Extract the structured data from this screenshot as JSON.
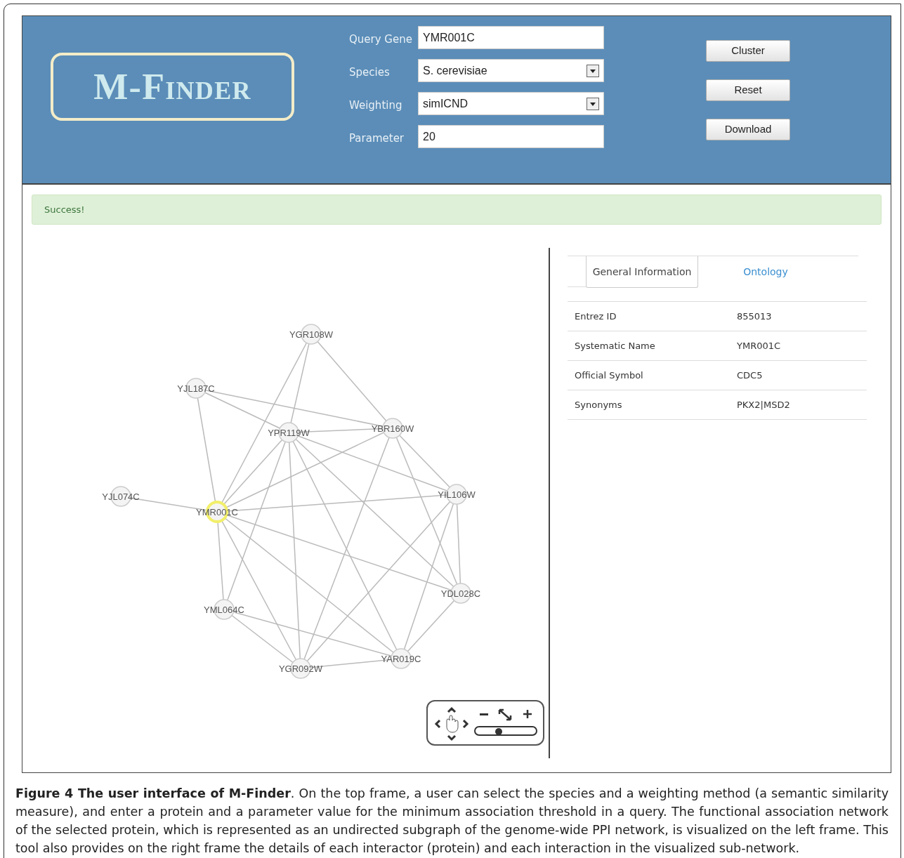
{
  "logo": "M-Finder",
  "form": [
    {
      "label": "Query Gene",
      "kind": "text",
      "value": "YMR001C"
    },
    {
      "label": "Species",
      "kind": "select",
      "value": "S. cerevisiae"
    },
    {
      "label": "Weighting",
      "kind": "select",
      "value": "simICND"
    },
    {
      "label": "Parameter",
      "kind": "text",
      "value": "20"
    }
  ],
  "buttons": [
    "Cluster",
    "Reset",
    "Download"
  ],
  "alert": "Success!",
  "network": {
    "nodes": [
      {
        "label": "YGR108W",
        "selected": false
      },
      {
        "label": "YJL187C",
        "selected": false
      },
      {
        "label": "YPR119W",
        "selected": false
      },
      {
        "label": "YBR160W",
        "selected": false
      },
      {
        "label": "YJL074C",
        "selected": false
      },
      {
        "label": "YMR001C",
        "selected": true
      },
      {
        "label": "YIL106W",
        "selected": false
      },
      {
        "label": "YDL028C",
        "selected": false
      },
      {
        "label": "YML064C",
        "selected": false
      },
      {
        "label": "YAR019C",
        "selected": false
      },
      {
        "label": "YGR092W",
        "selected": false
      }
    ],
    "zoom": {
      "level": 0.38
    }
  },
  "tabs": [
    {
      "label": "General Information",
      "selected": true
    },
    {
      "label": "Ontology",
      "selected": false
    }
  ],
  "details": [
    {
      "field": "Entrez ID",
      "value": "855013"
    },
    {
      "field": "Systematic Name",
      "value": "YMR001C"
    },
    {
      "field": "Official Symbol",
      "value": "CDC5"
    },
    {
      "field": "Synonyms",
      "value": "PKX2|MSD2"
    }
  ],
  "caption": "**Figure 4 The user interface of M-Finder**. On the top frame, a user can select the species and a weighting method (a semantic similarity measure), and enter a protein and a parameter value for the minimum association threshold in a query. The functional association network of the selected protein, which is represented as an undirected subgraph of the genome-wide PPI network, is visualized on the left frame. This tool also provides on the right frame the details of each interactor (protein) and each interaction in the visualized sub-network."
}
